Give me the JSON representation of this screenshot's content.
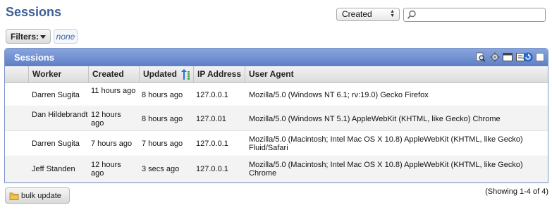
{
  "header": {
    "title": "Sessions",
    "sort_value": "Created",
    "search_value": ""
  },
  "filters": {
    "label": "Filters:",
    "value": "none"
  },
  "panel": {
    "title": "Sessions",
    "tools": [
      "search-icon",
      "gear-icon",
      "layout-icon",
      "export-icon",
      "refresh-icon"
    ]
  },
  "table": {
    "columns": [
      "Worker",
      "Created",
      "Updated",
      "IP Address",
      "User Agent"
    ],
    "sorted_column": "Updated",
    "rows": [
      {
        "worker": "Darren Sugita",
        "created": "11 hours ago",
        "updated": "8 hours ago",
        "ip": "127.0.0.1",
        "agent": "Mozilla/5.0 (Windows NT 6.1; rv:19.0) Gecko Firefox"
      },
      {
        "worker": "Dan Hildebrandt",
        "created": "12 hours ago",
        "updated": "8 hours ago",
        "ip": "127.0.01",
        "agent": "Mozilla/5.0 (Windows NT 5.1) AppleWebKit (KHTML, like Gecko) Chrome"
      },
      {
        "worker": "Darren Sugita",
        "created": "7 hours ago",
        "updated": "7 hours ago",
        "ip": "127.0.0.1",
        "agent": "Mozilla/5.0 (Macintosh; Intel Mac OS X 10.8) AppleWebKit (KHTML, like Gecko) Fluid/Safari"
      },
      {
        "worker": "Jeff Standen",
        "created": "12 hours ago",
        "updated": "3 secs ago",
        "ip": "127.0.0.1",
        "agent": "Mozilla/5.0 (Macintosh; Intel Mac OS X 10.8) AppleWebKit (KHTML, like Gecko) Chrome"
      }
    ]
  },
  "footer": {
    "bulk_label": "bulk update",
    "showing": "(Showing 1-4 of 4)"
  }
}
